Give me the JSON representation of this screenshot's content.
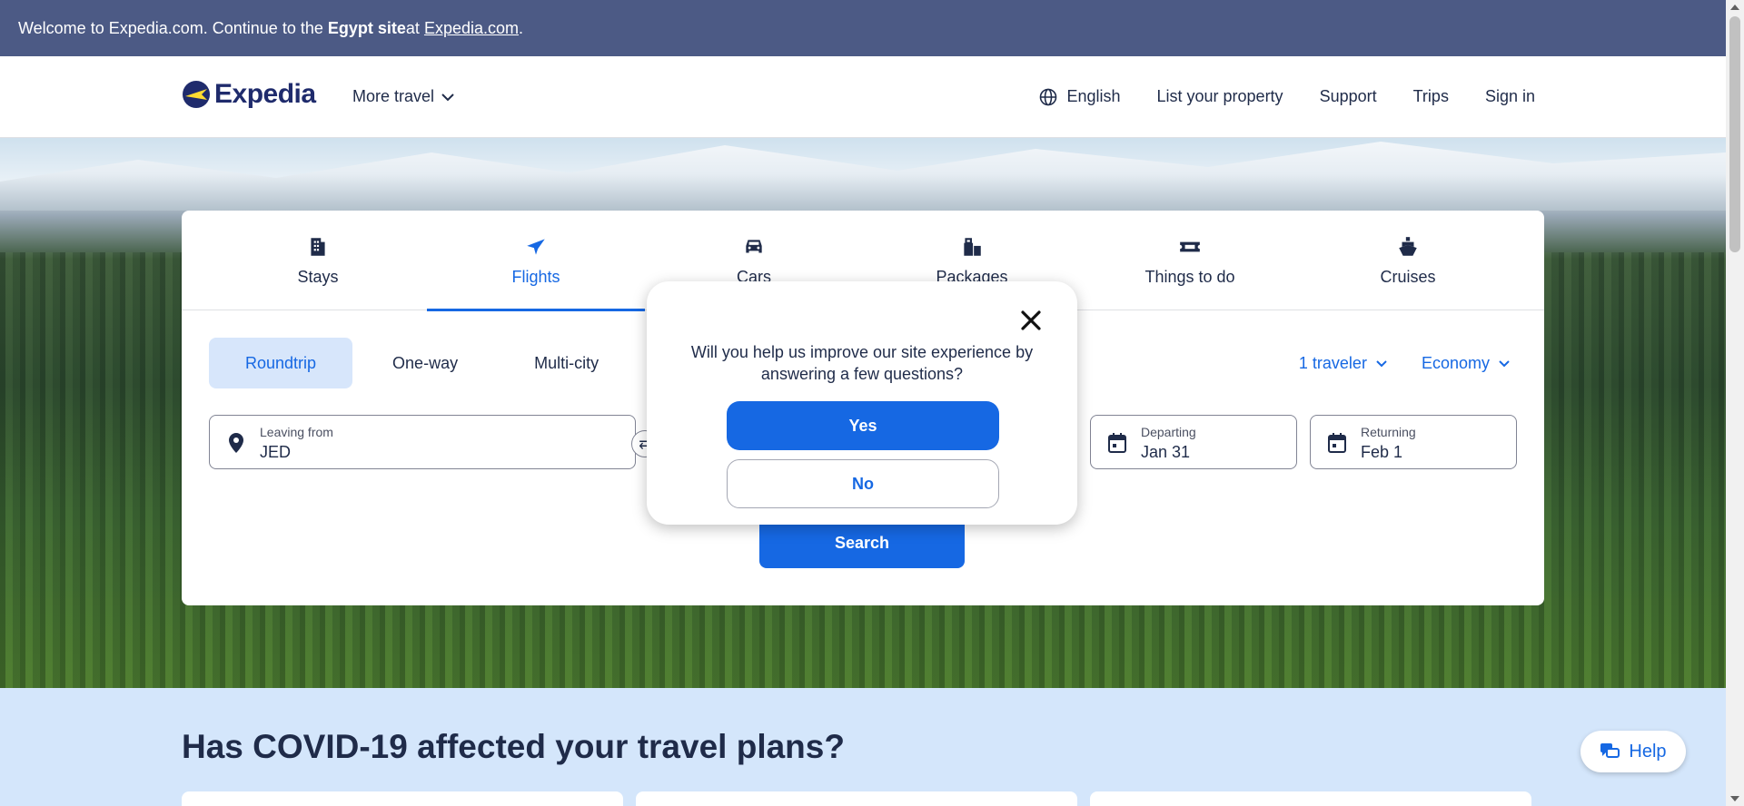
{
  "banner": {
    "prefix": "Welcome to Expedia.com. Continue to the ",
    "site": "Egypt site",
    "middle": " at ",
    "link": "Expedia.com",
    "suffix": "."
  },
  "header": {
    "logo": "Expedia",
    "more_travel": "More travel",
    "nav": {
      "language": "English",
      "list_property": "List your property",
      "support": "Support",
      "trips": "Trips",
      "sign_in": "Sign in"
    }
  },
  "search": {
    "tabs": [
      {
        "label": "Stays",
        "icon": "building-icon"
      },
      {
        "label": "Flights",
        "icon": "plane-icon"
      },
      {
        "label": "Cars",
        "icon": "car-icon"
      },
      {
        "label": "Packages",
        "icon": "luggage-icon"
      },
      {
        "label": "Things to do",
        "icon": "ticket-icon"
      },
      {
        "label": "Cruises",
        "icon": "ship-icon"
      }
    ],
    "active_tab": "Flights",
    "trip_types": [
      "Roundtrip",
      "One-way",
      "Multi-city"
    ],
    "active_trip": "Roundtrip",
    "travelers": "1 traveler",
    "cabin": "Economy",
    "leaving": {
      "label": "Leaving from",
      "value": "JED"
    },
    "departing": {
      "label": "Departing",
      "value": "Jan 31"
    },
    "returning": {
      "label": "Returning",
      "value": "Feb 1"
    },
    "search_label": "Search"
  },
  "survey": {
    "question": "Will you help us improve our site experience by answering a few questions?",
    "yes": "Yes",
    "no": "No"
  },
  "covid": {
    "title": "Has COVID-19 affected your travel plans?"
  },
  "help": {
    "label": "Help"
  },
  "colors": {
    "brand_blue": "#1668e3",
    "banner_bg": "#4c5a85",
    "text_dark": "#1f2b49",
    "covid_bg": "#d4e6fb"
  }
}
